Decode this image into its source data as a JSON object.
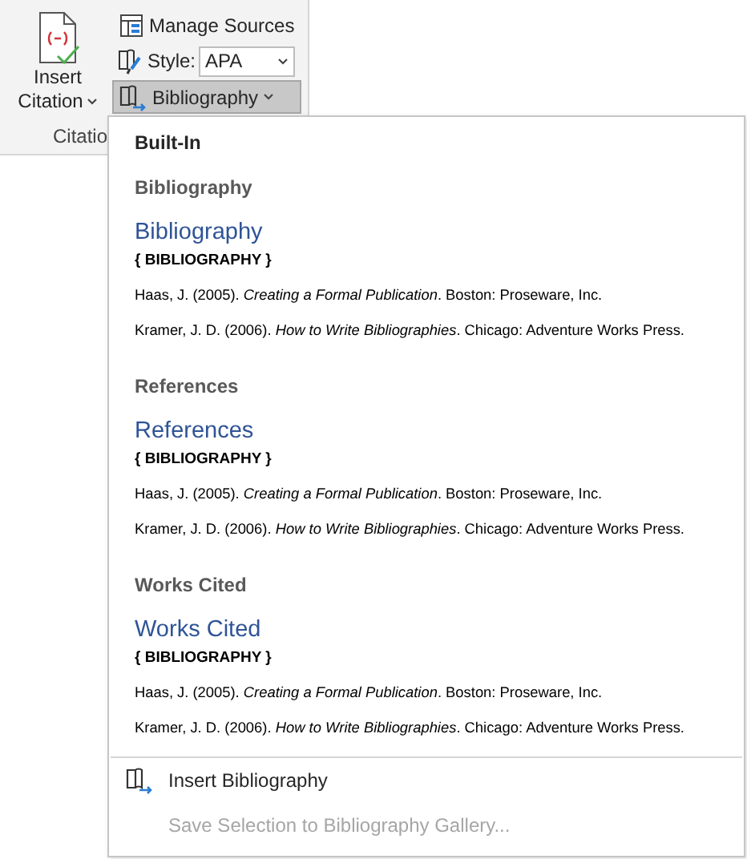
{
  "ribbon": {
    "insert_citation": {
      "lines": [
        "Insert",
        "Citation"
      ]
    },
    "manage_sources": "Manage Sources",
    "style": {
      "label": "Style:",
      "value": "APA"
    },
    "bibliography_button": {
      "label": "Bibliography",
      "selected": true
    },
    "group_label": "Citatio"
  },
  "menu": {
    "header": "Built-In",
    "gallery": [
      {
        "title": "Bibliography",
        "heading": "Bibliography",
        "field_code": "{ BIBLIOGRAPHY }",
        "entries": [
          "Haas, J. (2005). *Creating a Formal Publication*. Boston: Proseware, Inc.",
          "Kramer, J. D. (2006). *How to Write Bibliographies*. Chicago: Adventure Works Press."
        ]
      },
      {
        "title": "References",
        "heading": "References",
        "field_code": "{ BIBLIOGRAPHY }",
        "entries": [
          "Haas, J. (2005). *Creating a Formal Publication*. Boston: Proseware, Inc.",
          "Kramer, J. D. (2006). *How to Write Bibliographies*. Chicago: Adventure Works Press."
        ]
      },
      {
        "title": "Works Cited",
        "heading": "Works Cited",
        "field_code": "{ BIBLIOGRAPHY }",
        "entries": [
          "Haas, J. (2005). *Creating a Formal Publication*. Boston: Proseware, Inc.",
          "Kramer, J. D. (2006). *How to Write Bibliographies*. Chicago: Adventure Works Press."
        ]
      }
    ],
    "commands": [
      {
        "kind": "insert",
        "label": "Insert Bibliography",
        "disabled": false
      },
      {
        "kind": "save",
        "label": "Save Selection to Bibliography Gallery...",
        "disabled": true
      }
    ]
  }
}
